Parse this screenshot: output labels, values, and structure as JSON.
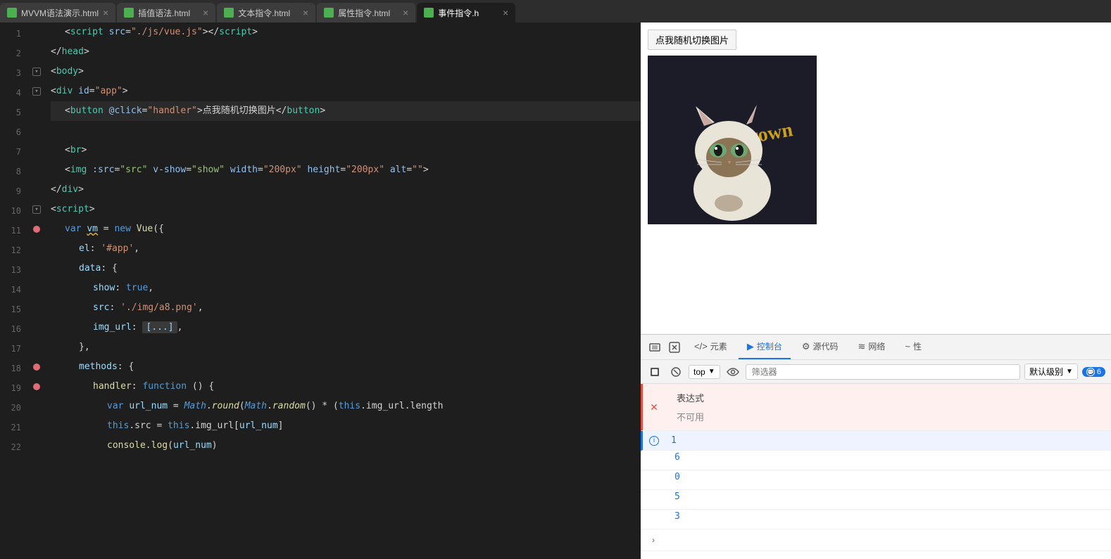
{
  "tabs": [
    {
      "label": "MVVM语法演示.html",
      "active": false,
      "icon": "green"
    },
    {
      "label": "插值语法.html",
      "active": false,
      "icon": "green"
    },
    {
      "label": "文本指令.html",
      "active": false,
      "icon": "green"
    },
    {
      "label": "属性指令.html",
      "active": false,
      "icon": "green"
    },
    {
      "label": "事件指令.h",
      "active": true,
      "icon": "green"
    }
  ],
  "code_lines": [
    {
      "num": 1,
      "indent": 1,
      "gutter": "none",
      "content": "&lt;script src=\"./js/vue.js\"&gt;&lt;/script&gt;"
    },
    {
      "num": 2,
      "indent": 0,
      "gutter": "none",
      "content": "&lt;/head&gt;"
    },
    {
      "num": 3,
      "indent": 0,
      "gutter": "fold",
      "content": "&lt;body&gt;"
    },
    {
      "num": 4,
      "indent": 0,
      "gutter": "fold",
      "content": "&lt;div id=\"app\"&gt;"
    },
    {
      "num": 5,
      "indent": 1,
      "gutter": "none",
      "content": "&lt;button @click=\"handler\"&gt;点我随机切换图片&lt;/button&gt;"
    },
    {
      "num": 6,
      "indent": 0,
      "gutter": "none",
      "content": ""
    },
    {
      "num": 7,
      "indent": 1,
      "gutter": "none",
      "content": "&lt;br&gt;"
    },
    {
      "num": 8,
      "indent": 1,
      "gutter": "none",
      "content": "&lt;img :src=\"src\" v-show=\"show\" width=\"200px\" height=\"200px\" alt=\"\"&gt;"
    },
    {
      "num": 9,
      "indent": 0,
      "gutter": "none",
      "content": "&lt;/div&gt;"
    },
    {
      "num": 10,
      "indent": 0,
      "gutter": "fold",
      "content": "&lt;script&gt;"
    },
    {
      "num": 11,
      "indent": 1,
      "gutter": "break",
      "content": "var vm = new Vue({"
    },
    {
      "num": 12,
      "indent": 2,
      "gutter": "none",
      "content": "el: '#app',"
    },
    {
      "num": 13,
      "indent": 2,
      "gutter": "none",
      "content": "data: {"
    },
    {
      "num": 14,
      "indent": 3,
      "gutter": "none",
      "content": "show: true,"
    },
    {
      "num": 15,
      "indent": 3,
      "gutter": "none",
      "content": "src: './img/a8.png',"
    },
    {
      "num": 16,
      "indent": 3,
      "gutter": "none",
      "content": "img_url: [...],"
    },
    {
      "num": 17,
      "indent": 2,
      "gutter": "none",
      "content": "},"
    },
    {
      "num": 18,
      "indent": 2,
      "gutter": "break",
      "content": "methods: {"
    },
    {
      "num": 19,
      "indent": 3,
      "gutter": "break",
      "content": "handler: function () {"
    },
    {
      "num": 20,
      "indent": 4,
      "gutter": "none",
      "content": "var url_num = Math.round(Math.random() * (this.img_url.length"
    },
    {
      "num": 21,
      "indent": 4,
      "gutter": "none",
      "content": "this.src = this.img_url[url_num]"
    },
    {
      "num": 22,
      "indent": 4,
      "gutter": "none",
      "content": "console.log(url_num)"
    }
  ],
  "preview": {
    "button_label": "点我随机切换图片"
  },
  "devtools": {
    "tabs": [
      {
        "label": "元素",
        "icon": "</>"
      },
      {
        "label": "控制台",
        "icon": "▶",
        "active": true
      },
      {
        "label": "源代码",
        "icon": "⚙"
      },
      {
        "label": "网络",
        "icon": "≋"
      },
      {
        "label": "性",
        "icon": "~"
      }
    ],
    "toolbar": {
      "context": "top",
      "filter_placeholder": "筛选器",
      "log_level": "默认级别",
      "error_count": "6"
    },
    "console_items": [
      {
        "type": "expression_label",
        "text": "表达式"
      },
      {
        "type": "unavailable",
        "text": "不可用"
      },
      {
        "type": "number",
        "value": "1"
      },
      {
        "type": "number",
        "value": "6"
      },
      {
        "type": "number",
        "value": "0"
      },
      {
        "type": "number",
        "value": "5"
      },
      {
        "type": "number",
        "value": "3"
      }
    ]
  }
}
